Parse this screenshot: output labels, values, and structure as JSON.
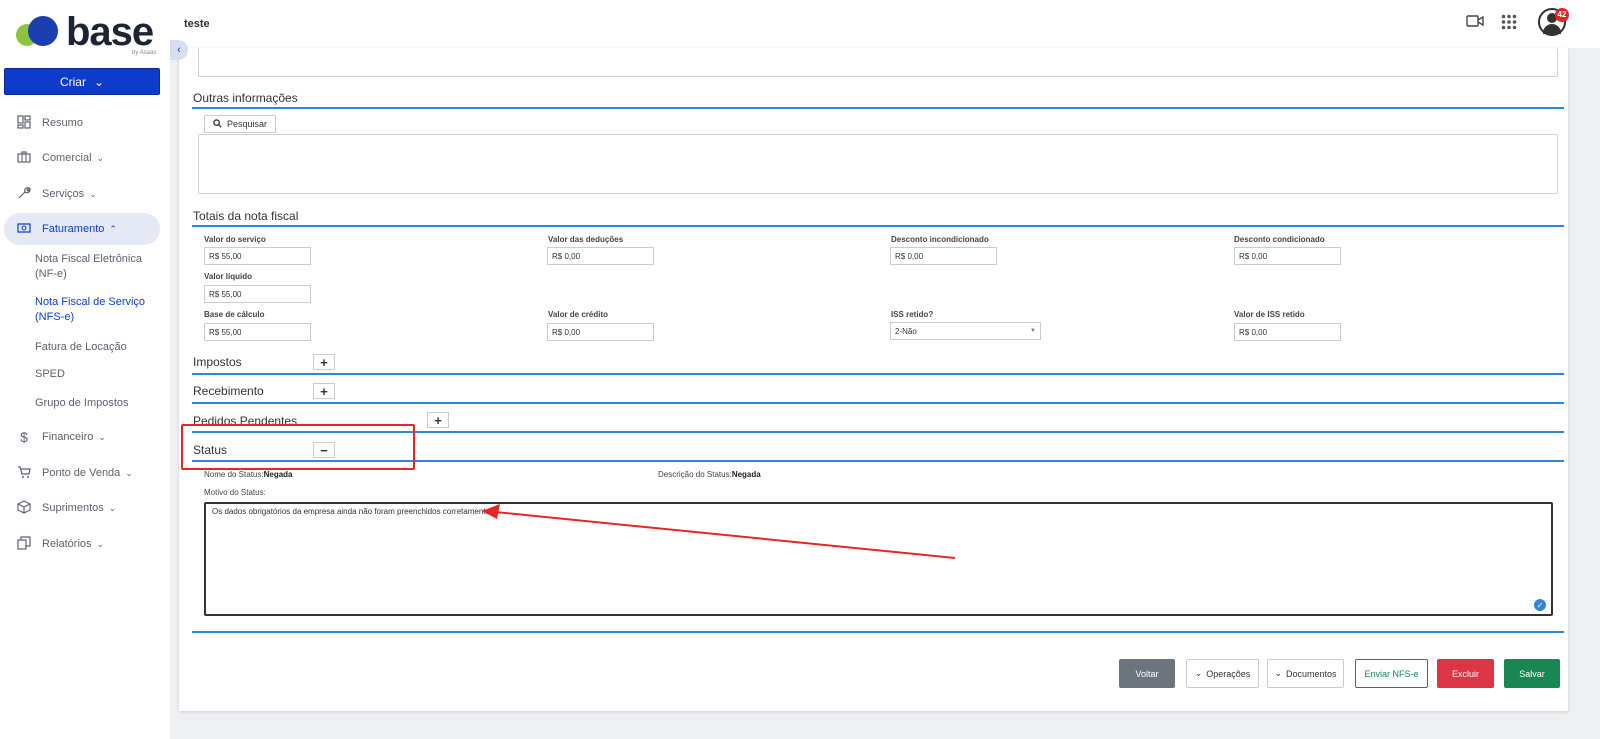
{
  "brand": {
    "name": "base",
    "byline": "by Asaas"
  },
  "sidebar": {
    "create_label": "Criar",
    "items": [
      {
        "label": "Resumo",
        "icon": "grid-icon"
      },
      {
        "label": "Comercial",
        "icon": "briefcase-icon"
      },
      {
        "label": "Serviços",
        "icon": "wrench-icon"
      },
      {
        "label": "Faturamento",
        "icon": "invoice-icon"
      },
      {
        "label": "Financeiro",
        "icon": "dollar-icon"
      },
      {
        "label": "Ponto de Venda",
        "icon": "cart-icon"
      },
      {
        "label": "Suprimentos",
        "icon": "box-icon"
      },
      {
        "label": "Relatórios",
        "icon": "reports-icon"
      }
    ],
    "sub_items": [
      "Nota Fiscal Eletrônica (NF-e)",
      "Nota Fiscal de Serviço (NFS-e)",
      "Fatura de Locação",
      "SPED",
      "Grupo de Impostos"
    ]
  },
  "header": {
    "title": "teste",
    "notification_count": "42"
  },
  "sections": {
    "outras": "Outras informações",
    "search_label": "Pesquisar",
    "totais": "Totais da nota fiscal",
    "impostos": "Impostos",
    "recebimento": "Recebimento",
    "pedidos": "Pedidos Pendentes",
    "status": "Status"
  },
  "totais": {
    "valor_servico": {
      "label": "Valor do serviço",
      "value": "R$ 55,00"
    },
    "valor_deducoes": {
      "label": "Valor das deduções",
      "value": "R$ 0,00"
    },
    "desc_incond": {
      "label": "Desconto incondicionado",
      "value": "R$ 0,00"
    },
    "desc_cond": {
      "label": "Desconto condicionado",
      "value": "R$ 0,00"
    },
    "valor_liquido": {
      "label": "Valor líquido",
      "value": "R$ 55,00"
    },
    "base_calculo": {
      "label": "Base de cálculo",
      "value": "R$ 55,00"
    },
    "valor_credito": {
      "label": "Valor de crédito",
      "value": "R$ 0,00"
    },
    "iss_retido": {
      "label": "ISS retido?",
      "value": "2-Não"
    },
    "valor_iss_retido": {
      "label": "Valor de ISS retido",
      "value": "R$ 0,00"
    }
  },
  "status": {
    "name_label": "Nome do Status:",
    "name_value": "Negada",
    "desc_label": "Descrição do Status:",
    "desc_value": "Negada",
    "motivo_label": "Motivo do Status:",
    "motivo_text": "Os dados obrigatórios da empresa ainda não foram preenchidos corretamente."
  },
  "footer": {
    "voltar": "Voltar",
    "operacoes": "Operações",
    "documentos": "Documentos",
    "enviar": "Enviar NFS-e",
    "excluir": "Excluir",
    "salvar": "Salvar"
  },
  "colors": {
    "accent": "#0c3cc9",
    "section_line": "#2f86d6",
    "highlight": "#e82424",
    "success": "#198754",
    "danger": "#dc3545"
  }
}
